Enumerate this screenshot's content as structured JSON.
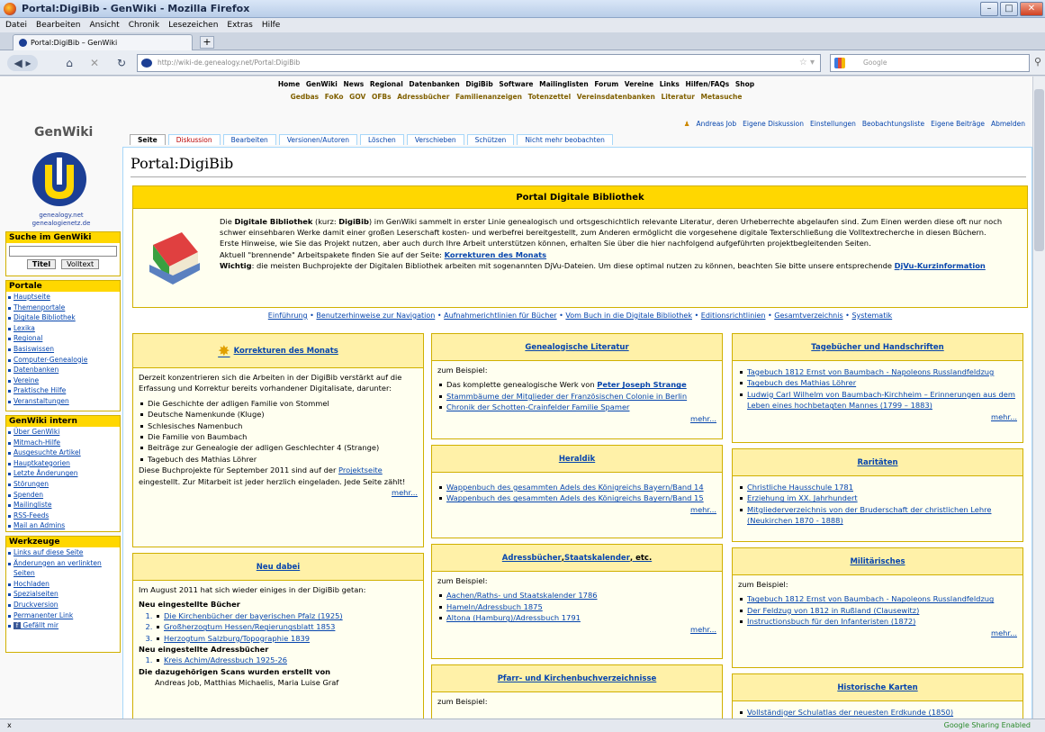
{
  "window": {
    "title": "Portal:DigiBib - GenWiki - Mozilla Firefox"
  },
  "menu": [
    "Datei",
    "Bearbeiten",
    "Ansicht",
    "Chronik",
    "Lesezeichen",
    "Extras",
    "Hilfe"
  ],
  "tab": {
    "label": "Portal:DigiBib – GenWiki"
  },
  "nav": {
    "url": "http://wiki-de.genealogy.net/Portal:DigiBib",
    "search_placeholder": "Google"
  },
  "status": {
    "left": "x",
    "right": "Google Sharing Enabled"
  },
  "topnav1": [
    "Home",
    "GenWiki",
    "News",
    "Regional",
    "Datenbanken",
    "DigiBib",
    "Software",
    "Mailinglisten",
    "Forum",
    "Vereine",
    "Links",
    "Hilfen/FAQs",
    "Shop"
  ],
  "topnav2": [
    "Gedbas",
    "FoKo",
    "GOV",
    "OFBs",
    "Adressbücher",
    "Familienanzeigen",
    "Totenzettel",
    "Vereinsdatenbanken",
    "Literatur",
    "Metasuche"
  ],
  "userlinks": [
    "Andreas Job",
    "Eigene Diskussion",
    "Einstellungen",
    "Beobachtungsliste",
    "Eigene Beiträge",
    "Abmelden"
  ],
  "sidebar": {
    "title": "GenWiki",
    "sub1": "genealogy.net",
    "sub2": "genealogienetz.de",
    "search_title": "Suche im GenWiki",
    "btn_title": "Titel",
    "btn_full": "Volltext",
    "portale_title": "Portale",
    "portale": [
      "Hauptseite",
      "Themenportale",
      "Digitale Bibliothek",
      "Lexika",
      "Regional",
      "Basiswissen",
      "Computer-Genealogie",
      "Datenbanken",
      "Vereine",
      "Praktische Hilfe",
      "Veranstaltungen"
    ],
    "intern_title": "GenWiki intern",
    "intern": [
      "Über GenWiki",
      "Mitmach-Hilfe",
      "Ausgesuchte Artikel",
      "Hauptkategorien",
      "Letzte Änderungen",
      "Störungen",
      "Spenden",
      "Mailingliste",
      "RSS-Feeds",
      "Mail an Admins"
    ],
    "tools_title": "Werkzeuge",
    "tools": [
      "Links auf diese Seite",
      "Änderungen an verlinkten Seiten",
      "Hochladen",
      "Spezialseiten",
      "Druckversion",
      "Permanenter Link",
      "Gefällt mir"
    ]
  },
  "pagetabs": [
    "Seite",
    "Diskussion",
    "Bearbeiten",
    "Versionen/Autoren",
    "Löschen",
    "Verschieben",
    "Schützen",
    "Nicht mehr beobachten"
  ],
  "page_title": "Portal:DigiBib",
  "portal_head": "Portal Digitale Bibliothek",
  "intro": {
    "p1a": "Die ",
    "p1b": "Digitale Bibliothek",
    "p1c": " (kurz: ",
    "p1d": "DigiBib",
    "p1e": ") im GenWiki sammelt in erster Linie genealogisch und ortsgeschichtlich relevante Literatur, deren Urheberrechte abgelaufen sind. Zum Einen werden diese oft nur noch schwer einsehbaren Werke damit einer großen Leserschaft kosten- und werbefrei bereitgestellt, zum Anderen ermöglicht die vorgesehene digitale Texterschließung die Volltextrecherche in diesen Büchern.",
    "p2": "Erste Hinweise, wie Sie das Projekt nutzen, aber auch durch Ihre Arbeit unterstützen können, erhalten Sie über die hier nachfolgend aufgeführten projektbegleitenden Seiten.",
    "p3a": "Aktuell \"brennende\" Arbeitspakete finden Sie auf der Seite: ",
    "p3b": "Korrekturen des Monats",
    "p4a": "Wichtig",
    "p4b": ": die meisten Buchprojekte der Digitalen Bibliothek arbeiten mit sogenannten DjVu-Dateien. Um diese optimal nutzen zu können, beachten Sie bitte unsere entsprechende ",
    "p4c": "DjVu-Kurzinformation"
  },
  "intro_links": [
    "Einführung",
    "Benutzerhinweise zur Navigation",
    "Aufnahmerichtlinien für Bücher",
    "Vom Buch in die Digitale Bibliothek",
    "Editionsrichtlinien",
    "Gesamtverzeichnis",
    "Systematik"
  ],
  "korrekturen": {
    "title": "Korrekturen des Monats",
    "p1": "Derzeit konzentrieren sich die Arbeiten in der DigiBib verstärkt auf die Erfassung und Korrektur bereits vorhandener Digitalisate, darunter:",
    "items": [
      "Die Geschichte der adligen Familie von Stommel",
      "Deutsche Namenkunde (Kluge)",
      "Schlesisches Namenbuch",
      "Die Familie von Baumbach",
      "Beiträge zur Genealogie der adligen Geschlechter 4 (Strange)",
      "Tagebuch des Mathias Löhrer"
    ],
    "p2a": "Diese Buchprojekte für September 2011 sind auf der ",
    "p2b": "Projektseite",
    "p2c": " eingestellt. Zur Mitarbeit ist jeder herzlich eingeladen. Jede Seite zählt!",
    "more": "mehr..."
  },
  "neu": {
    "title": "Neu dabei",
    "p1": "Im August 2011 hat sich wieder einiges in der DigiBib getan:",
    "h1": "Neu eingestellte Bücher",
    "books": [
      "Die Kirchenbücher der bayerischen Pfalz (1925)",
      "Großherzogtum Hessen/Regierungsblatt 1853",
      "Herzogtum Salzburg/Topographie 1839"
    ],
    "h2": "Neu eingestellte Adressbücher",
    "addr": [
      "Kreis Achim/Adressbuch 1925-26"
    ],
    "h3": "Die dazugehörigen Scans wurden erstellt von",
    "cut": "Andreas Job, Matthias Michaelis, Maria Luise Graf"
  },
  "genlit": {
    "title": "Genealogische Literatur",
    "lead": "zum Beispiel:",
    "i1a": "Das komplette genealogische Werk von ",
    "i1b": "Peter Joseph Strange",
    "items": [
      "Stammbäume der Mitglieder der Französischen Colonie in Berlin",
      "Chronik der Schotten-Crainfelder Familie Spamer"
    ],
    "more": "mehr..."
  },
  "heraldik": {
    "title": "Heraldik",
    "items": [
      "Wappenbuch des gesammten Adels des Königreichs Bayern/Band 14",
      "Wappenbuch des gesammten Adels des Königreichs Bayern/Band 15"
    ],
    "more": "mehr..."
  },
  "adress": {
    "t1": "Adressbücher",
    "t2": ", ",
    "t3": "Staatskalender",
    "t4": ", etc.",
    "lead": "zum Beispiel:",
    "items": [
      "Aachen/Raths- und Staatskalender 1786",
      "Hameln/Adressbuch 1875",
      "Altona (Hamburg)/Adressbuch 1791"
    ],
    "more": "mehr..."
  },
  "pfarr": {
    "title": "Pfarr- und Kirchenbuchverzeichnisse",
    "lead": "zum Beispiel:"
  },
  "tagebuch": {
    "title": "Tagebücher und Handschriften",
    "items": [
      "Tagebuch 1812 Ernst von Baumbach - Napoleons Russlandfeldzug",
      "Tagebuch des Mathias Löhrer",
      "Ludwig Carl Wilhelm von Baumbach-Kirchheim – Erinnerungen aus dem Leben eines hochbetagten Mannes (1799 – 1883)"
    ],
    "more": "mehr..."
  },
  "rar": {
    "title": "Raritäten",
    "items": [
      "Christliche Hausschule 1781",
      "Erziehung im XX. Jahrhundert",
      "Mitgliederverzeichnis von der Bruderschaft der christlichen Lehre (Neukirchen 1870 - 1888)"
    ]
  },
  "mil": {
    "title": "Militärisches",
    "lead": "zum Beispiel:",
    "items": [
      "Tagebuch 1812 Ernst von Baumbach - Napoleons Russlandfeldzug",
      "Der Feldzug von 1812 in Rußland (Clausewitz)",
      "Instructionsbuch für den Infanteristen (1872)"
    ],
    "more": "mehr..."
  },
  "karten": {
    "title": "Historische Karten",
    "items": [
      "Vollständiger Schulatlas der neuesten Erdkunde (1850)"
    ]
  }
}
